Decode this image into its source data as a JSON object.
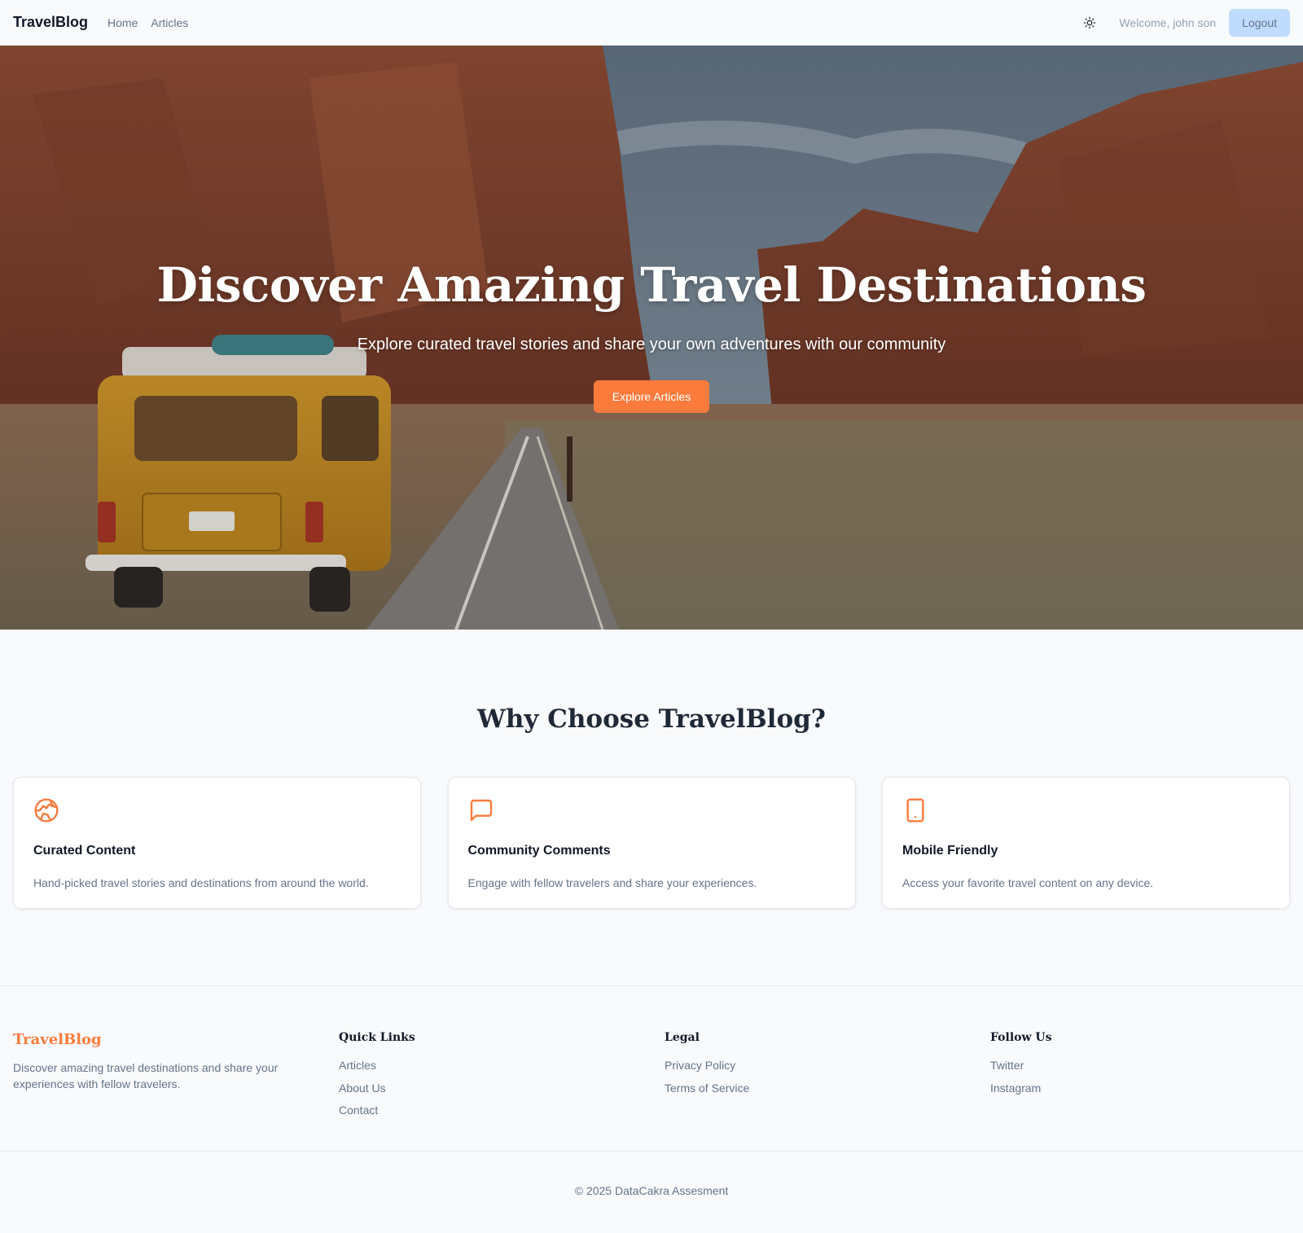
{
  "navbar": {
    "brand": "TravelBlog",
    "links": [
      "Home",
      "Articles"
    ],
    "theme_icon": "sun-icon",
    "welcome": "Welcome, john son",
    "logout_label": "Logout"
  },
  "hero": {
    "title": "Discover Amazing Travel Destinations",
    "subtitle": "Explore curated travel stories and share your own adventures with our community",
    "cta_label": "Explore Articles"
  },
  "why": {
    "title": "Why Choose TravelBlog?",
    "cards": [
      {
        "icon": "globe-icon",
        "title": "Curated Content",
        "text": "Hand-picked travel stories and destinations from around the world."
      },
      {
        "icon": "message-icon",
        "title": "Community Comments",
        "text": "Engage with fellow travelers and share your experiences."
      },
      {
        "icon": "tablet-icon",
        "title": "Mobile Friendly",
        "text": "Access your favorite travel content on any device."
      }
    ]
  },
  "footer": {
    "brand": "TravelBlog",
    "description": "Discover amazing travel destinations and share your experiences with fellow travelers.",
    "quick_links": {
      "heading": "Quick Links",
      "items": [
        "Articles",
        "About Us",
        "Contact"
      ]
    },
    "legal": {
      "heading": "Legal",
      "items": [
        "Privacy Policy",
        "Terms of Service"
      ]
    },
    "follow": {
      "heading": "Follow Us",
      "items": [
        "Twitter",
        "Instagram"
      ]
    },
    "copyright": "© 2025 DataCakra Assesment"
  },
  "colors": {
    "accent": "#fb7b3c",
    "logout_bg": "#bfdbfe",
    "page_bg": "#f8fafc"
  }
}
